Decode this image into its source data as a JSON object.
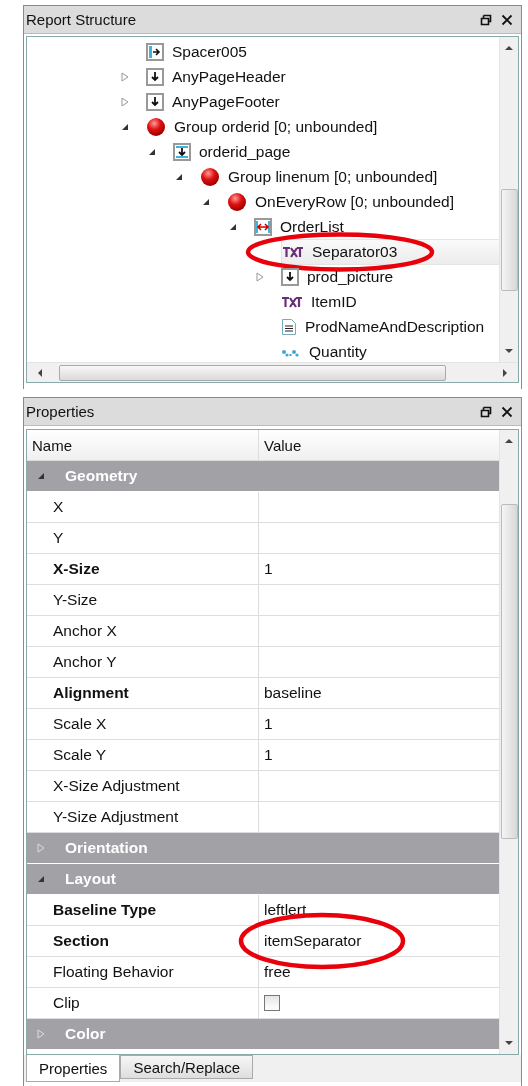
{
  "structure_panel": {
    "title": "Report Structure",
    "tree": [
      {
        "label": "Spacer005",
        "kind": "spacer",
        "selected": false
      },
      {
        "label": "AnyPageHeader",
        "kind": "band",
        "selected": false,
        "expanded": false
      },
      {
        "label": "AnyPageFooter",
        "kind": "band",
        "selected": false,
        "expanded": false
      },
      {
        "label": "Group orderid [0; unbounded]",
        "kind": "group",
        "selected": false,
        "expanded": true,
        "children": [
          {
            "label": "orderid_page",
            "kind": "page",
            "selected": false,
            "expanded": true,
            "children": [
              {
                "label": "Group linenum [0; unbounded]",
                "kind": "group",
                "selected": false,
                "expanded": true,
                "children": [
                  {
                    "label": "OnEveryRow [0; unbounded]",
                    "kind": "group",
                    "selected": false,
                    "expanded": true,
                    "children": [
                      {
                        "label": "OrderList",
                        "kind": "list",
                        "selected": false,
                        "expanded": true,
                        "children": [
                          {
                            "label": "Separator03",
                            "kind": "text",
                            "selected": true
                          },
                          {
                            "label": "prod_picture",
                            "kind": "band",
                            "selected": false,
                            "expanded": false
                          },
                          {
                            "label": "ItemID",
                            "kind": "text",
                            "selected": false
                          },
                          {
                            "label": "ProdNameAndDescription",
                            "kind": "doc",
                            "selected": false
                          },
                          {
                            "label": "Quantity",
                            "kind": "field",
                            "selected": false
                          }
                        ]
                      }
                    ]
                  }
                ]
              }
            ]
          }
        ]
      }
    ]
  },
  "properties_panel": {
    "title": "Properties",
    "columns": [
      "Name",
      "Value"
    ],
    "rows": [
      {
        "kind": "group",
        "label": "Geometry",
        "expanded": true
      },
      {
        "kind": "prop",
        "name": "X",
        "value": "",
        "modified": false
      },
      {
        "kind": "prop",
        "name": "Y",
        "value": "",
        "modified": false
      },
      {
        "kind": "prop",
        "name": "X-Size",
        "value": "1",
        "modified": true
      },
      {
        "kind": "prop",
        "name": "Y-Size",
        "value": "",
        "modified": false
      },
      {
        "kind": "prop",
        "name": "Anchor X",
        "value": "",
        "modified": false
      },
      {
        "kind": "prop",
        "name": "Anchor Y",
        "value": "",
        "modified": false
      },
      {
        "kind": "prop",
        "name": "Alignment",
        "value": "baseline",
        "modified": true
      },
      {
        "kind": "prop",
        "name": "Scale X",
        "value": "1",
        "modified": false
      },
      {
        "kind": "prop",
        "name": "Scale Y",
        "value": "1",
        "modified": false
      },
      {
        "kind": "prop",
        "name": "X-Size Adjustment",
        "value": "",
        "modified": false
      },
      {
        "kind": "prop",
        "name": "Y-Size Adjustment",
        "value": "",
        "modified": false
      },
      {
        "kind": "group",
        "label": "Orientation",
        "expanded": false
      },
      {
        "kind": "group",
        "label": "Layout",
        "expanded": true
      },
      {
        "kind": "prop",
        "name": "Baseline Type",
        "value": "leftlert",
        "modified": true
      },
      {
        "kind": "prop",
        "name": "Section",
        "value": "itemSeparator",
        "modified": true,
        "highlighted": true
      },
      {
        "kind": "prop",
        "name": "Floating Behavior",
        "value": "free",
        "modified": false
      },
      {
        "kind": "check",
        "name": "Clip",
        "checked": false,
        "modified": false
      },
      {
        "kind": "group",
        "label": "Color",
        "expanded": false
      }
    ]
  },
  "tabs": [
    {
      "label": "Properties",
      "selected": true
    },
    {
      "label": "Search/Replace",
      "selected": false
    }
  ]
}
